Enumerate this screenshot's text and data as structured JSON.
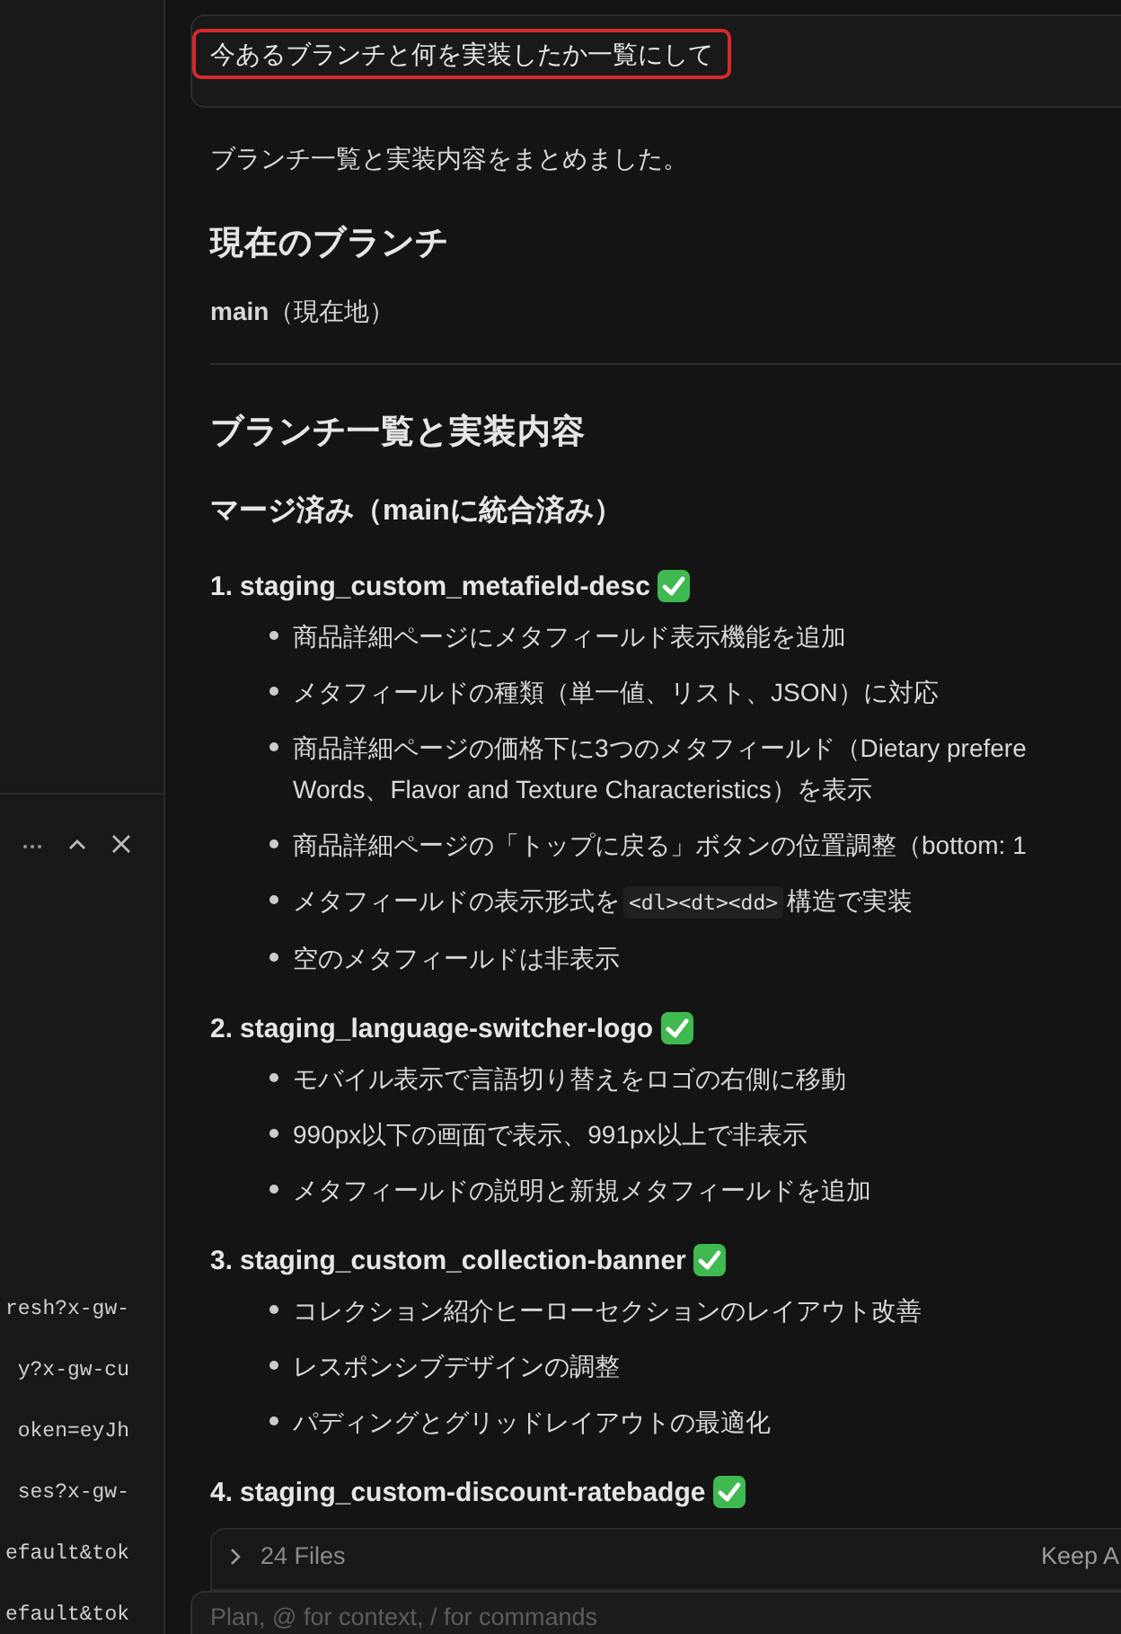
{
  "sidebar": {
    "terminal": {
      "lines": [
        "resh?x-gw-",
        "y?x-gw-cu",
        "oken=eyJh",
        "ses?x-gw-",
        "efault&tok",
        "efault&tok"
      ]
    }
  },
  "chat": {
    "user_message": "今あるブランチと何を実装したか一覧にして",
    "reply": [
      {
        "kind": "paragraph",
        "text": "ブランチ一覧と実装内容をまとめました。"
      },
      {
        "kind": "heading",
        "text": "現在のブランチ"
      },
      {
        "kind": "paragraph",
        "text": "**main**（現在地）"
      },
      {
        "kind": "rule"
      },
      {
        "kind": "heading",
        "text": "ブランチ一覧と実装内容"
      },
      {
        "kind": "subheading",
        "text": "マージ済み（mainに統合済み）"
      },
      {
        "kind": "item",
        "number": "1.",
        "title": "staging_custom_metafield-desc",
        "bullets": [
          "商品詳細ページにメタフィールド表示機能を追加",
          "メタフィールドの種類（単一値、リスト、JSON）に対応",
          "商品詳細ページの価格下に3つのメタフィールド（Dietary prefere\nWords、Flavor and Texture Characteristics）を表示",
          "商品詳細ページの「トップに戻る」ボタンの位置調整（bottom: 1",
          {
            "segments": [
              {
                "kind": "text",
                "text": "メタフィールドの表示形式を"
              },
              {
                "kind": "code",
                "text": "<dl><dt><dd>"
              },
              {
                "kind": "text",
                "text": "構造で実装"
              }
            ]
          },
          "空のメタフィールドは非表示"
        ]
      },
      {
        "kind": "item",
        "number": "2.",
        "title": "staging_language-switcher-logo",
        "bullets": [
          "モバイル表示で言語切り替えをロゴの右側に移動",
          "990px以下の画面で表示、991px以上で非表示",
          "メタフィールドの説明と新規メタフィールドを追加"
        ]
      },
      {
        "kind": "item",
        "number": "3.",
        "title": "staging_custom_collection-banner",
        "bullets": [
          "コレクション紹介ヒーローセクションのレイアウト改善",
          "レスポンシブデザインの調整",
          "パディングとグリッドレイアウトの最適化"
        ]
      },
      {
        "kind": "item",
        "number": "4.",
        "title": "staging_custom-discount-ratebadge"
      }
    ]
  },
  "files_bar": {
    "label": "24 Files",
    "action": "Keep A"
  },
  "composer": {
    "placeholder": "Plan, @ for context, / for commands"
  }
}
